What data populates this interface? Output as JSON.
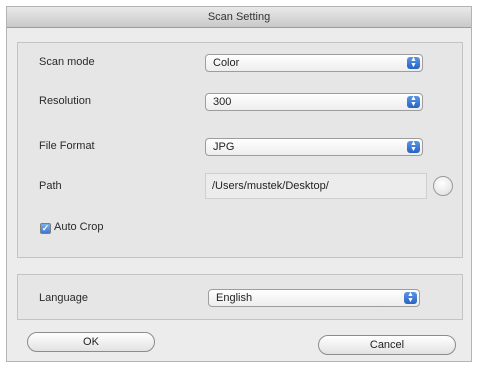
{
  "window": {
    "title": "Scan Setting"
  },
  "scan_mode": {
    "label": "Scan mode",
    "value": "Color"
  },
  "resolution": {
    "label": "Resolution",
    "value": "300"
  },
  "file_format": {
    "label": "File Format",
    "value": "JPG"
  },
  "path": {
    "label": "Path",
    "value": "/Users/mustek/Desktop/"
  },
  "auto_crop": {
    "label": "Auto Crop",
    "checked": true
  },
  "language": {
    "label": "Language",
    "value": "English"
  },
  "buttons": {
    "ok": "OK",
    "cancel": "Cancel"
  },
  "icons": {
    "popup_arrows": "up-down-arrows-icon",
    "check": "checkmark-icon",
    "browse": "browse-button"
  },
  "colors": {
    "accent": "#2f6fd0",
    "window_bg": "#ececec"
  }
}
